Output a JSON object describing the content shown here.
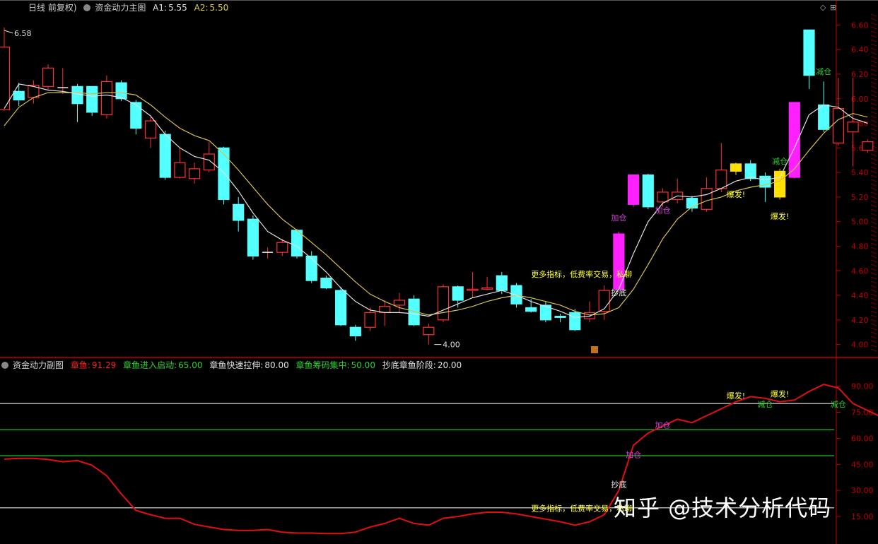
{
  "header": {
    "main": {
      "period": "日线 前复权)",
      "indicator": "资金动力主图",
      "a1_label": "A1:",
      "a1_value": "5.55",
      "a2_label": "A2:",
      "a2_value": "5.50"
    },
    "sub": {
      "indicator": "资金动力副图",
      "zhangyu_label": "章鱼:",
      "zhangyu_value": "91.29",
      "start_label": "章鱼进入启动:",
      "start_value": "65.00",
      "pull_label": "章鱼快速拉伸:",
      "pull_value": "80.00",
      "gather_label": "章鱼筹码集中:",
      "gather_value": "50.00",
      "bottom_label": "抄底章鱼阶段:",
      "bottom_value": "20.00"
    }
  },
  "watermark": "知乎 @技术分析代码",
  "colors": {
    "up": "#ff3030",
    "down": "#54ffff",
    "signal_pink": "#ff20ff",
    "signal_yellow": "#ffe000",
    "ma_white": "#e0e0e0",
    "ma_yellow": "#d8c050",
    "axis": "#c00000",
    "osc": "#e01010",
    "label_yellow": "#ffff30",
    "label_green": "#30d030",
    "label_magenta": "#e040e0"
  },
  "chart_data": [
    {
      "type": "candlestick",
      "panel": "main",
      "ylim": [
        3.9,
        6.7
      ],
      "y_ticks": [
        "6.60",
        "6.40",
        "6.20",
        "6.00",
        "5.80",
        "5.60",
        "5.40",
        "5.20",
        "5.00",
        "4.80",
        "4.60",
        "4.40",
        "4.20",
        "4.00"
      ],
      "candles": [
        {
          "o": 5.91,
          "c": 6.42,
          "h": 6.58,
          "l": 5.9
        },
        {
          "o": 6.06,
          "c": 5.99,
          "h": 6.13,
          "l": 5.94
        },
        {
          "o": 6.01,
          "c": 6.11,
          "h": 6.15,
          "l": 5.96
        },
        {
          "o": 6.1,
          "c": 6.25,
          "h": 6.28,
          "l": 6.07
        },
        {
          "o": 6.09,
          "c": 6.09,
          "h": 6.25,
          "l": 6.04
        },
        {
          "o": 6.1,
          "c": 5.96,
          "h": 6.12,
          "l": 5.81
        },
        {
          "o": 6.1,
          "c": 5.89,
          "h": 6.1,
          "l": 5.86
        },
        {
          "o": 5.87,
          "c": 6.14,
          "h": 6.19,
          "l": 5.84
        },
        {
          "o": 6.13,
          "c": 6.0,
          "h": 6.15,
          "l": 5.98
        },
        {
          "o": 5.97,
          "c": 5.76,
          "h": 5.99,
          "l": 5.71
        },
        {
          "o": 5.68,
          "c": 5.82,
          "h": 5.85,
          "l": 5.6
        },
        {
          "o": 5.71,
          "c": 5.36,
          "h": 5.74,
          "l": 5.34
        },
        {
          "o": 5.36,
          "c": 5.48,
          "h": 5.6,
          "l": 5.35
        },
        {
          "o": 5.35,
          "c": 5.43,
          "h": 5.48,
          "l": 5.31
        },
        {
          "o": 5.42,
          "c": 5.55,
          "h": 5.65,
          "l": 5.4
        },
        {
          "o": 5.6,
          "c": 5.18,
          "h": 5.61,
          "l": 5.14
        },
        {
          "o": 5.14,
          "c": 5.01,
          "h": 5.2,
          "l": 4.92
        },
        {
          "o": 5.02,
          "c": 4.72,
          "h": 5.05,
          "l": 4.69
        },
        {
          "o": 4.75,
          "c": 4.75,
          "h": 4.79,
          "l": 4.7
        },
        {
          "o": 4.75,
          "c": 4.83,
          "h": 4.86,
          "l": 4.72
        },
        {
          "o": 4.93,
          "c": 4.72,
          "h": 4.94,
          "l": 4.7
        },
        {
          "o": 4.72,
          "c": 4.52,
          "h": 4.76,
          "l": 4.5
        },
        {
          "o": 4.54,
          "c": 4.46,
          "h": 4.56,
          "l": 4.45
        },
        {
          "o": 4.44,
          "c": 4.16,
          "h": 4.47,
          "l": 4.15
        },
        {
          "o": 4.14,
          "c": 4.07,
          "h": 4.16,
          "l": 4.03
        },
        {
          "o": 4.14,
          "c": 4.26,
          "h": 4.3,
          "l": 4.11
        },
        {
          "o": 4.26,
          "c": 4.31,
          "h": 4.36,
          "l": 4.15
        },
        {
          "o": 4.32,
          "c": 4.36,
          "h": 4.42,
          "l": 4.26
        },
        {
          "o": 4.37,
          "c": 4.16,
          "h": 4.4,
          "l": 4.15
        },
        {
          "o": 4.08,
          "c": 4.14,
          "h": 4.17,
          "l": 4.0
        },
        {
          "o": 4.2,
          "c": 4.47,
          "h": 4.49,
          "l": 4.18
        },
        {
          "o": 4.47,
          "c": 4.36,
          "h": 4.48,
          "l": 4.3
        },
        {
          "o": 4.44,
          "c": 4.45,
          "h": 4.59,
          "l": 4.38
        },
        {
          "o": 4.45,
          "c": 4.46,
          "h": 4.55,
          "l": 4.44
        },
        {
          "o": 4.56,
          "c": 4.44,
          "h": 4.59,
          "l": 4.41
        },
        {
          "o": 4.48,
          "c": 4.33,
          "h": 4.5,
          "l": 4.3
        },
        {
          "o": 4.3,
          "c": 4.27,
          "h": 4.37,
          "l": 4.26
        },
        {
          "o": 4.32,
          "c": 4.2,
          "h": 4.35,
          "l": 4.18
        },
        {
          "o": 4.23,
          "c": 4.22,
          "h": 4.25,
          "l": 4.18
        },
        {
          "o": 4.26,
          "c": 4.12,
          "h": 4.29,
          "l": 4.11
        },
        {
          "o": 4.21,
          "c": 4.26,
          "h": 4.35,
          "l": 4.18
        },
        {
          "o": 4.27,
          "c": 4.44,
          "h": 4.48,
          "l": 4.2
        },
        {
          "o": 4.45,
          "c": 4.9,
          "h": 4.92,
          "l": 4.44
        },
        {
          "o": 5.14,
          "c": 5.38,
          "h": 5.38,
          "l": 5.12
        },
        {
          "o": 5.38,
          "c": 5.12,
          "h": 5.39,
          "l": 5.1
        },
        {
          "o": 5.16,
          "c": 5.24,
          "h": 5.27,
          "l": 5.12
        },
        {
          "o": 5.18,
          "c": 5.24,
          "h": 5.35,
          "l": 5.15
        },
        {
          "o": 5.19,
          "c": 5.11,
          "h": 5.21,
          "l": 5.08
        },
        {
          "o": 5.1,
          "c": 5.27,
          "h": 5.36,
          "l": 5.08
        },
        {
          "o": 5.27,
          "c": 5.42,
          "h": 5.64,
          "l": 5.24
        },
        {
          "o": 5.41,
          "c": 5.47,
          "h": 5.48,
          "l": 5.38
        },
        {
          "o": 5.47,
          "c": 5.35,
          "h": 5.5,
          "l": 5.33
        },
        {
          "o": 5.37,
          "c": 5.28,
          "h": 5.4,
          "l": 5.16
        },
        {
          "o": 5.2,
          "c": 5.41,
          "h": 5.43,
          "l": 5.18
        },
        {
          "o": 5.36,
          "c": 5.97,
          "h": 5.97,
          "l": 5.35
        },
        {
          "o": 6.56,
          "c": 6.19,
          "h": 6.56,
          "l": 6.08
        },
        {
          "o": 5.95,
          "c": 5.75,
          "h": 6.14,
          "l": 5.73
        },
        {
          "o": 5.64,
          "c": 5.92,
          "h": 6.17,
          "l": 5.62
        },
        {
          "o": 5.73,
          "c": 5.81,
          "h": 6.17,
          "l": 5.45
        },
        {
          "o": 5.58,
          "c": 5.65,
          "h": 5.67,
          "l": 5.56
        }
      ],
      "ma_white": [
        5.92,
        6.12,
        6.1,
        6.07,
        6.06,
        6.04,
        6.02,
        6.03,
        6.01,
        5.95,
        5.86,
        5.71,
        5.6,
        5.53,
        5.5,
        5.4,
        5.25,
        5.07,
        4.92,
        4.85,
        4.8,
        4.7,
        4.59,
        4.46,
        4.35,
        4.28,
        4.26,
        4.26,
        4.25,
        4.23,
        4.28,
        4.33,
        4.38,
        4.41,
        4.44,
        4.4,
        4.35,
        4.31,
        4.27,
        4.22,
        4.23,
        4.29,
        4.45,
        4.74,
        5.0,
        5.15,
        5.21,
        5.2,
        5.22,
        5.27,
        5.33,
        5.36,
        5.34,
        5.36,
        5.6,
        5.87,
        5.95,
        5.93,
        5.84,
        5.8
      ],
      "ma_yellow": [
        5.78,
        5.93,
        6.01,
        6.05,
        6.05,
        6.05,
        6.04,
        6.05,
        6.05,
        6.03,
        5.95,
        5.85,
        5.76,
        5.7,
        5.66,
        5.55,
        5.42,
        5.28,
        5.14,
        5.02,
        4.93,
        4.83,
        4.73,
        4.62,
        4.51,
        4.41,
        4.35,
        4.3,
        4.27,
        4.24,
        4.26,
        4.28,
        4.31,
        4.35,
        4.38,
        4.4,
        4.38,
        4.35,
        4.32,
        4.27,
        4.24,
        4.25,
        4.3,
        4.45,
        4.65,
        4.86,
        5.02,
        5.12,
        5.17,
        5.2,
        5.25,
        5.28,
        5.3,
        5.33,
        5.43,
        5.58,
        5.72,
        5.83,
        5.88,
        5.85
      ],
      "signals": {
        "pink_bars": [
          42,
          43,
          54
        ],
        "yellow_bars": [
          50,
          53
        ]
      },
      "annotations": [
        {
          "i": 0,
          "price": 6.58,
          "text": "6.58",
          "color": "white"
        },
        {
          "i": 29,
          "price": 4.0,
          "text": "4.00",
          "color": "white"
        },
        {
          "i": 42,
          "price": 4.4,
          "text": "抄底",
          "color": "white"
        },
        {
          "i": 42,
          "price": 5.01,
          "text": "加仓",
          "color": "magenta"
        },
        {
          "i": 45,
          "price": 5.07,
          "text": "加仓",
          "color": "magenta"
        },
        {
          "i": 36,
          "price": 4.55,
          "text": "更多指标，低费率交易，私聊",
          "color": "yellow"
        },
        {
          "i": 50,
          "price": 5.2,
          "text": "爆发!",
          "color": "yellow"
        },
        {
          "i": 53,
          "price": 5.02,
          "text": "爆发!",
          "color": "yellow"
        },
        {
          "i": 53,
          "price": 5.47,
          "text": "减仓",
          "color": "green"
        },
        {
          "i": 56,
          "price": 6.2,
          "text": "减仓",
          "color": "green"
        }
      ]
    },
    {
      "type": "line",
      "panel": "sub",
      "name": "章鱼",
      "ylim": [
        0,
        100
      ],
      "y_ticks": [
        "90.00",
        "75.00",
        "60.00",
        "45.00",
        "30.00",
        "15.00"
      ],
      "levels": [
        {
          "value": 80,
          "color": "white"
        },
        {
          "value": 65,
          "color": "green"
        },
        {
          "value": 50,
          "color": "green"
        },
        {
          "value": 20,
          "color": "white"
        }
      ],
      "values": [
        48,
        48.5,
        48.5,
        47.8,
        46.5,
        47.2,
        44.5,
        38.5,
        28,
        18.5,
        16,
        14,
        14,
        10.5,
        9,
        7.5,
        7,
        7,
        7.5,
        6,
        5.5,
        5.5,
        5.2,
        5.2,
        6,
        9,
        11,
        14,
        11,
        10,
        14,
        15,
        16.5,
        17.5,
        17.5,
        16.5,
        15,
        13.5,
        12,
        10,
        12,
        16,
        30,
        56,
        63,
        67,
        71,
        69,
        73,
        77,
        81,
        84,
        83,
        81,
        82,
        87,
        91,
        89,
        80,
        76,
        72,
        68
      ],
      "annotations": [
        {
          "i": 42,
          "value": 32,
          "text": "抄底",
          "color": "white"
        },
        {
          "i": 43,
          "value": 49,
          "text": "加仓",
          "color": "magenta"
        },
        {
          "i": 45,
          "value": 66,
          "text": "加仓",
          "color": "magenta"
        },
        {
          "i": 36,
          "value": 18,
          "text": "更多指标，低费率交易，私聊",
          "color": "yellow"
        },
        {
          "i": 50,
          "value": 83,
          "text": "爆发!",
          "color": "yellow"
        },
        {
          "i": 53,
          "value": 84,
          "text": "爆发!",
          "color": "yellow"
        },
        {
          "i": 52,
          "value": 78,
          "text": "减仓",
          "color": "green"
        },
        {
          "i": 57,
          "value": 78,
          "text": "减仓",
          "color": "green"
        }
      ]
    }
  ]
}
